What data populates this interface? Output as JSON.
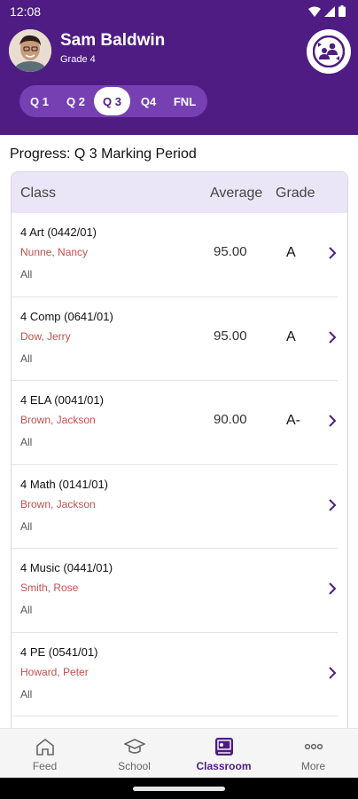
{
  "status": {
    "time": "12:08"
  },
  "student": {
    "name": "Sam Baldwin",
    "grade": "Grade 4"
  },
  "periods": [
    {
      "label": "Q 1",
      "active": false
    },
    {
      "label": "Q 2",
      "active": false
    },
    {
      "label": "Q 3",
      "active": true
    },
    {
      "label": "Q4",
      "active": false
    },
    {
      "label": "FNL",
      "active": false
    }
  ],
  "progress_title": "Progress: Q 3 Marking Period",
  "table": {
    "headers": {
      "class": "Class",
      "average": "Average",
      "grade": "Grade"
    },
    "rows": [
      {
        "course": "4 Art (0442/01)",
        "teacher": "Nunne, Nancy",
        "section": "All",
        "average": "95.00",
        "grade": "A"
      },
      {
        "course": "4 Comp (0641/01)",
        "teacher": "Dow, Jerry",
        "section": "All",
        "average": "95.00",
        "grade": "A"
      },
      {
        "course": "4 ELA (0041/01)",
        "teacher": "Brown, Jackson",
        "section": "All",
        "average": "90.00",
        "grade": "A-"
      },
      {
        "course": "4 Math (0141/01)",
        "teacher": "Brown, Jackson",
        "section": "All",
        "average": "",
        "grade": ""
      },
      {
        "course": "4 Music (0441/01)",
        "teacher": "Smith, Rose",
        "section": "All",
        "average": "",
        "grade": ""
      },
      {
        "course": "4 PE (0541/01)",
        "teacher": "Howard, Peter",
        "section": "All",
        "average": "",
        "grade": ""
      }
    ]
  },
  "nav": [
    {
      "label": "Feed",
      "icon": "home-icon",
      "active": false
    },
    {
      "label": "School",
      "icon": "graduation-cap-icon",
      "active": false
    },
    {
      "label": "Classroom",
      "icon": "classroom-icon",
      "active": true
    },
    {
      "label": "More",
      "icon": "more-icon",
      "active": false
    }
  ],
  "colors": {
    "brand": "#4e1c82",
    "tab_track": "#7640b3",
    "teacher_text": "#c0514d",
    "header_row": "#ebe6f7"
  }
}
